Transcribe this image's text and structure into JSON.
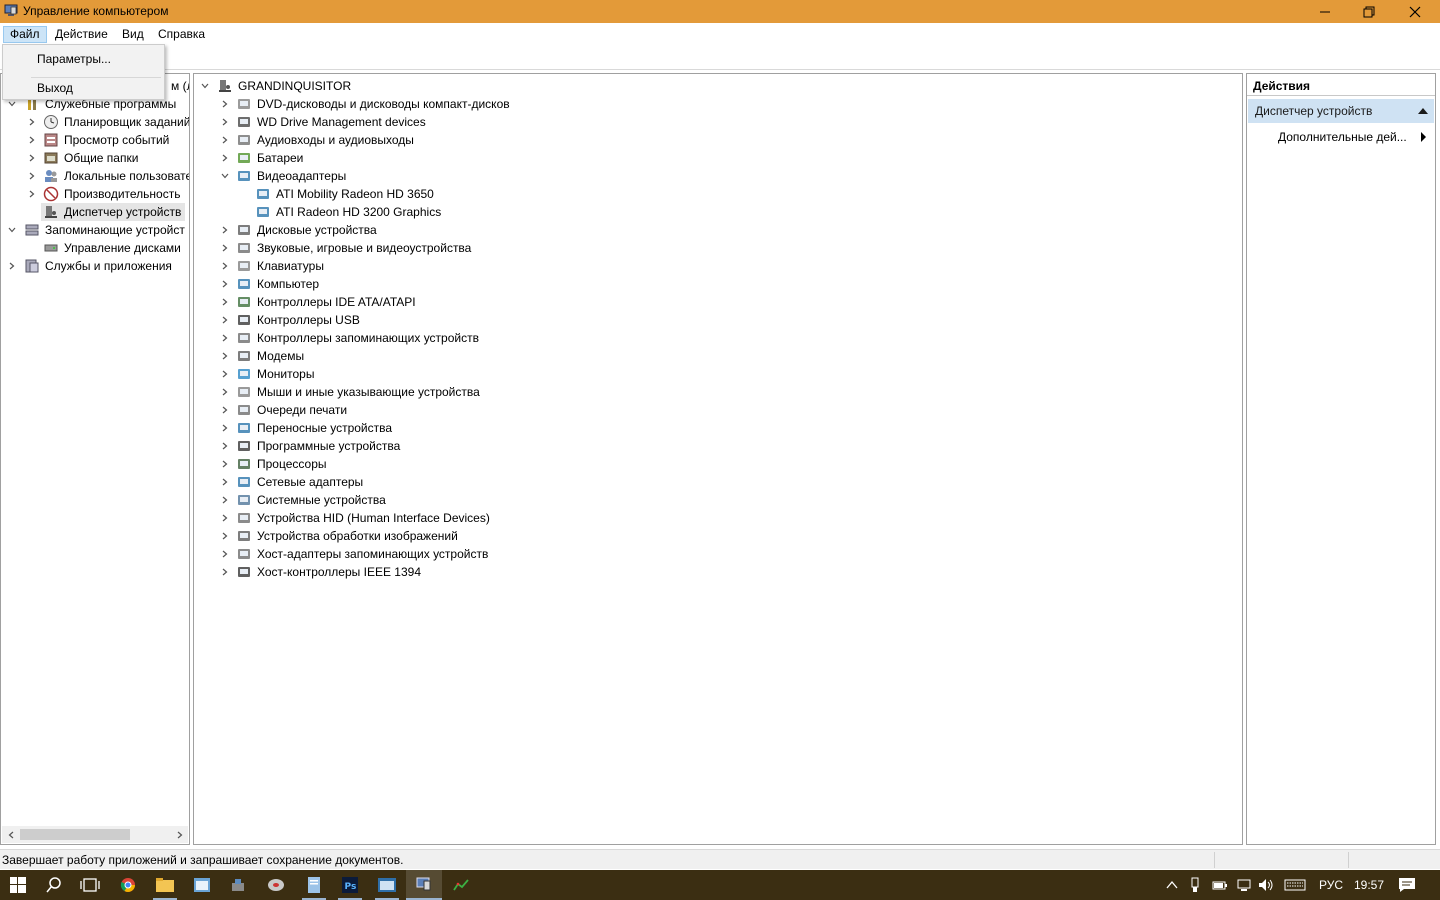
{
  "window": {
    "title": "Управление компьютером",
    "accent": "#e39a39"
  },
  "menu": {
    "items": [
      "Файл",
      "Действие",
      "Вид",
      "Справка"
    ],
    "active": "Файл"
  },
  "dropdown": {
    "items": [
      "Параметры...",
      "Выход"
    ]
  },
  "left_tree": {
    "items": [
      {
        "label": "м (л",
        "icon": "computer-icon"
      },
      {
        "label": "Служебные программы",
        "icon": "tools-icon"
      },
      {
        "label": "Планировщик заданий",
        "icon": "clock-icon"
      },
      {
        "label": "Просмотр событий",
        "icon": "event-viewer-icon"
      },
      {
        "label": "Общие папки",
        "icon": "shared-folder-icon"
      },
      {
        "label": "Локальные пользовате",
        "icon": "users-icon"
      },
      {
        "label": "Производительность",
        "icon": "performance-icon"
      },
      {
        "label": "Диспетчер устройств",
        "icon": "device-manager-icon"
      },
      {
        "label": "Запоминающие устройст",
        "icon": "storage-icon"
      },
      {
        "label": "Управление дисками",
        "icon": "disk-management-icon"
      },
      {
        "label": "Службы и приложения",
        "icon": "services-icon"
      }
    ]
  },
  "device_tree": {
    "root": "GRANDINQUISITOR",
    "items": [
      {
        "label": "DVD-дисководы и дисководы компакт-дисков",
        "icon": "dvd-drive-icon"
      },
      {
        "label": "WD Drive Management devices",
        "icon": "wd-device-icon"
      },
      {
        "label": "Аудиовходы и аудиовыходы",
        "icon": "audio-icon"
      },
      {
        "label": "Батареи",
        "icon": "battery-icon"
      },
      {
        "label": "Видеоадаптеры",
        "icon": "display-adapter-icon"
      },
      {
        "label": "ATI Mobility Radeon HD 3650",
        "icon": "display-adapter-icon"
      },
      {
        "label": "ATI Radeon HD 3200 Graphics",
        "icon": "display-adapter-icon"
      },
      {
        "label": "Дисковые устройства",
        "icon": "disk-drive-icon"
      },
      {
        "label": "Звуковые, игровые и видеоустройства",
        "icon": "sound-icon"
      },
      {
        "label": "Клавиатуры",
        "icon": "keyboard-icon"
      },
      {
        "label": "Компьютер",
        "icon": "computer-icon"
      },
      {
        "label": "Контроллеры IDE ATA/ATAPI",
        "icon": "ide-controller-icon"
      },
      {
        "label": "Контроллеры USB",
        "icon": "usb-icon"
      },
      {
        "label": "Контроллеры запоминающих устройств",
        "icon": "storage-controller-icon"
      },
      {
        "label": "Модемы",
        "icon": "modem-icon"
      },
      {
        "label": "Мониторы",
        "icon": "monitor-icon"
      },
      {
        "label": "Мыши и иные указывающие устройства",
        "icon": "mouse-icon"
      },
      {
        "label": "Очереди печати",
        "icon": "printer-icon"
      },
      {
        "label": "Переносные устройства",
        "icon": "portable-device-icon"
      },
      {
        "label": "Программные устройства",
        "icon": "software-device-icon"
      },
      {
        "label": "Процессоры",
        "icon": "processor-icon"
      },
      {
        "label": "Сетевые адаптеры",
        "icon": "network-adapter-icon"
      },
      {
        "label": "Системные устройства",
        "icon": "system-device-icon"
      },
      {
        "label": "Устройства HID (Human Interface Devices)",
        "icon": "hid-icon"
      },
      {
        "label": "Устройства обработки изображений",
        "icon": "imaging-device-icon"
      },
      {
        "label": "Хост-адаптеры запоминающих устройств",
        "icon": "storage-adapter-icon"
      },
      {
        "label": "Хост-контроллеры IEEE 1394",
        "icon": "ieee1394-icon"
      }
    ]
  },
  "actions": {
    "header": "Действия",
    "section": "Диспетчер устройств",
    "item": "Дополнительные дей..."
  },
  "status": {
    "text": "Завершает работу приложений и запрашивает сохранение документов."
  },
  "taskbar": {
    "language": "РУС",
    "time": "19:57"
  }
}
